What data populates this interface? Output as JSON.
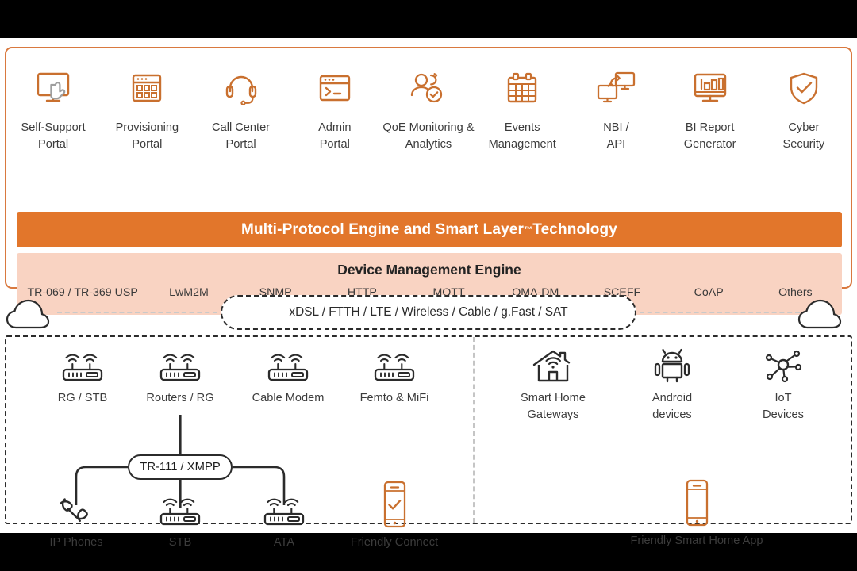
{
  "platform": {
    "portals": [
      {
        "label": "Self-Support\nPortal",
        "icon": "monitor-cursor-icon"
      },
      {
        "label": "Provisioning\nPortal",
        "icon": "grid-window-icon"
      },
      {
        "label": "Call Center\nPortal",
        "icon": "headset-icon"
      },
      {
        "label": "Admin\nPortal",
        "icon": "terminal-window-icon"
      },
      {
        "label": "QoE Monitoring &\nAnalytics",
        "icon": "user-check-icon"
      },
      {
        "label": "Events\nManagement",
        "icon": "calendar-icon"
      },
      {
        "label": "NBI /\nAPI",
        "icon": "monitor-sync-icon"
      },
      {
        "label": "BI Report\nGenerator",
        "icon": "bar-chart-monitor-icon"
      },
      {
        "label": "Cyber\nSecurity",
        "icon": "shield-check-icon"
      }
    ],
    "engine_banner": {
      "text_before": "Multi-Protocol Engine and Smart Layer",
      "trademark": "™",
      "text_after": " Technology"
    },
    "dme": {
      "title": "Device Management Engine",
      "protocols": [
        "TR-069 / TR-369 USP",
        "LwM2M",
        "SNMP",
        "HTTP",
        "MQTT",
        "OMA-DM",
        "SCEFF",
        "CoAP",
        "Others"
      ]
    }
  },
  "network": {
    "access_technologies": "xDSL / FTTH / LTE / Wireless / Cable / g.Fast / SAT",
    "cloud_left": "cloud-icon",
    "cloud_right": "cloud-icon"
  },
  "devices": {
    "left": {
      "connector_label": "TR-111 / XMPP",
      "row1": [
        {
          "label": "RG / STB",
          "icon": "router-icon"
        },
        {
          "label": "Routers / RG",
          "icon": "router-icon"
        },
        {
          "label": "Cable Modem",
          "icon": "router-icon"
        },
        {
          "label": "Femto & MiFi",
          "icon": "router-icon"
        }
      ],
      "row2": [
        {
          "label": "IP Phones",
          "icon": "phone-handset-icon"
        },
        {
          "label": "STB",
          "icon": "router-icon"
        },
        {
          "label": "ATA",
          "icon": "router-icon"
        },
        {
          "label": "Friendly Connect",
          "icon": "smartphone-check-icon"
        }
      ]
    },
    "right": {
      "items": [
        {
          "label": "Smart Home\nGateways",
          "icon": "smart-home-icon"
        },
        {
          "label": "Android\ndevices",
          "icon": "android-robot-icon"
        },
        {
          "label": "IoT\nDevices",
          "icon": "iot-network-icon"
        }
      ],
      "app": {
        "label": "Friendly Smart Home App",
        "icon": "smartphone-icon"
      }
    }
  },
  "colors": {
    "accent_orange": "#E2762B",
    "card_border": "#D9793F",
    "icon_orange": "#C9702F",
    "band_pink": "#F9D3C2",
    "text_dark": "#3c3c3c",
    "line_dark": "#2b2b2b",
    "letterbox": "#000000"
  }
}
